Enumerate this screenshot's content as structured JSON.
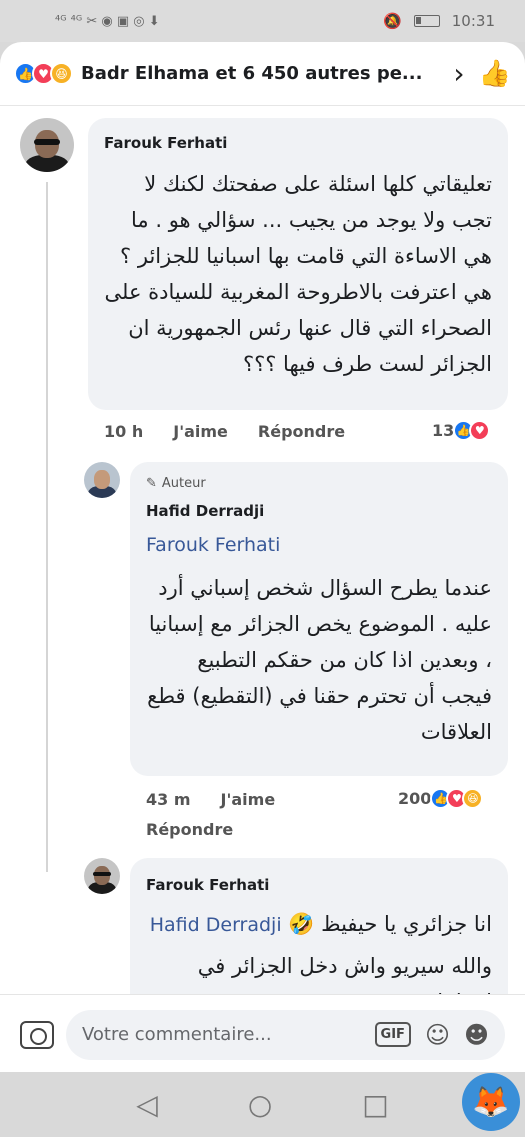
{
  "status": {
    "left_icons": "⁴ᴳ ⁴ᴳ ✂ ◉ ▣ ◎ ⬇",
    "time": "10:31"
  },
  "header": {
    "reactions": [
      "like-icon",
      "love-icon",
      "haha-icon"
    ],
    "summary": "Badr Elhama et 6 450 autres pe...",
    "chevron": "›",
    "like_icon": "thumbs-up-icon"
  },
  "comments": [
    {
      "author": "Farouk Ferhati",
      "text": "تعليقاتي كلها اسئلة على صفحتك لكنك لا تجب ولا يوجد من يجيب ... سؤالي هو . ما هي الاساءة التي قامت بها اسبانيا للجزائر ؟ هي اعترفت بالاطروحة المغربية للسيادة على الصحراء التي قال عنها رئس الجمهورية ان الجزائر لست طرف فيها ؟؟؟",
      "time": "10 h",
      "like": "J'aime",
      "reply": "Répondre",
      "reaction_count": "13"
    },
    {
      "author_badge": "Auteur",
      "author": "Hafid Derradji",
      "mention": "Farouk Ferhati",
      "text": "عندما يطرح السؤال شخص إسباني أرد عليه . الموضوع يخص الجزائر مع إسبانيا ، وبعدين اذا كان من حقكم التطبيع فيجب أن تحترم حقنا في (التقطيع) قطع العلاقات",
      "time": "43 m",
      "like": "J'aime",
      "reply": "Répondre",
      "reaction_count": "200"
    },
    {
      "author": "Farouk Ferhati",
      "mention": "Hafid Derradji",
      "emoji": "🤣",
      "text_line1": "انا جزائري يا حيفيظ",
      "text_line2": "والله سيريو واش دخل الجزائر في اسبانيا"
    }
  ],
  "composer": {
    "placeholder": "Votre commentaire...",
    "gif": "GIF"
  },
  "nav": {
    "back": "◁",
    "home": "○",
    "recents": "□"
  }
}
